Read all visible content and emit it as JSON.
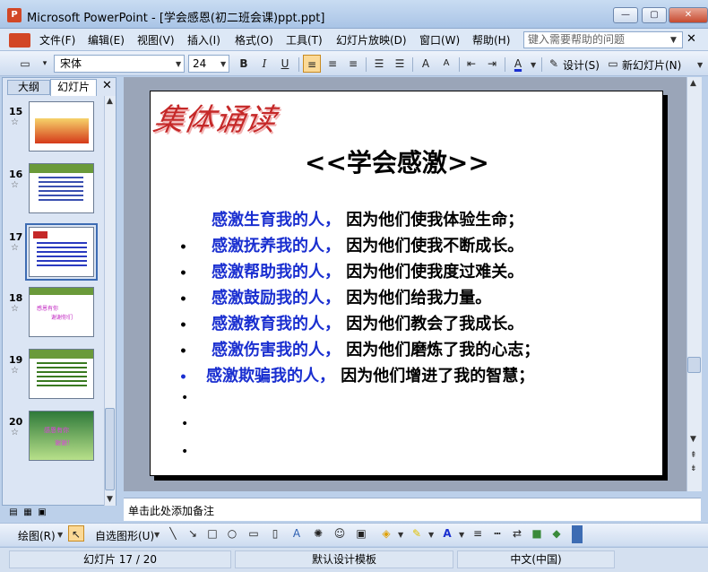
{
  "window": {
    "app_icon": "P",
    "title": "Microsoft PowerPoint - [学会感恩(初二班会课)ppt.ppt]",
    "min": "—",
    "max": "▢",
    "close": "✕"
  },
  "menu": {
    "items": [
      "文件(F)",
      "编辑(E)",
      "视图(V)",
      "插入(I)",
      "格式(O)",
      "工具(T)",
      "幻灯片放映(D)",
      "窗口(W)",
      "帮助(H)"
    ],
    "help_placeholder": "键入需要帮助的问题",
    "close": "✕"
  },
  "toolbar": {
    "font": "宋体",
    "size": "24",
    "bold": "B",
    "italic": "I",
    "underline": "U",
    "design_label": "设计(S)",
    "new_slide_label": "新幻灯片(N)"
  },
  "left_panel": {
    "tab_outline": "大纲",
    "tab_slides": "幻灯片",
    "close": "✕",
    "thumbnails": [
      {
        "num": "15",
        "star": "☆"
      },
      {
        "num": "16",
        "star": "☆"
      },
      {
        "num": "17",
        "star": "☆"
      },
      {
        "num": "18",
        "star": "☆"
      },
      {
        "num": "19",
        "star": "☆"
      },
      {
        "num": "20",
        "star": "☆"
      }
    ],
    "thumb18_text": [
      "感恩有你",
      "谢谢你们"
    ],
    "thumb20_text": [
      "感恩有你",
      "谢谢！"
    ]
  },
  "slide": {
    "logo": "集体诵读",
    "title": "<<学会感激>>",
    "lines": [
      {
        "bullet": "",
        "blue": "感激生育我的人，",
        "black": " 因为他们使我体验生命；"
      },
      {
        "bullet": "•",
        "blue": "感激抚养我的人，",
        "black": " 因为他们使我不断成长。"
      },
      {
        "bullet": "•",
        "blue": "感激帮助我的人，",
        "black": " 因为他们使我度过难关。"
      },
      {
        "bullet": "•",
        "blue": "感激鼓励我的人，",
        "black": " 因为他们给我力量。"
      },
      {
        "bullet": "•",
        "blue": "感激教育我的人，",
        "black": " 因为他们教会了我成长。"
      },
      {
        "bullet": "•",
        "blue": "感激伤害我的人，",
        "black": " 因为他们磨炼了我的心志；"
      },
      {
        "bullet": "•",
        "blue": "感激欺骗我的人，",
        "black": " 因为他们增进了我的智慧；"
      }
    ],
    "empty_bullet": "•"
  },
  "notes": {
    "placeholder": "单击此处添加备注"
  },
  "drawbar": {
    "draw_label": "绘图(R)",
    "autoshape_label": "自选图形(U)"
  },
  "status": {
    "slide_pos": "幻灯片 17 / 20",
    "template": "默认设计模板",
    "language": "中文(中国)"
  }
}
